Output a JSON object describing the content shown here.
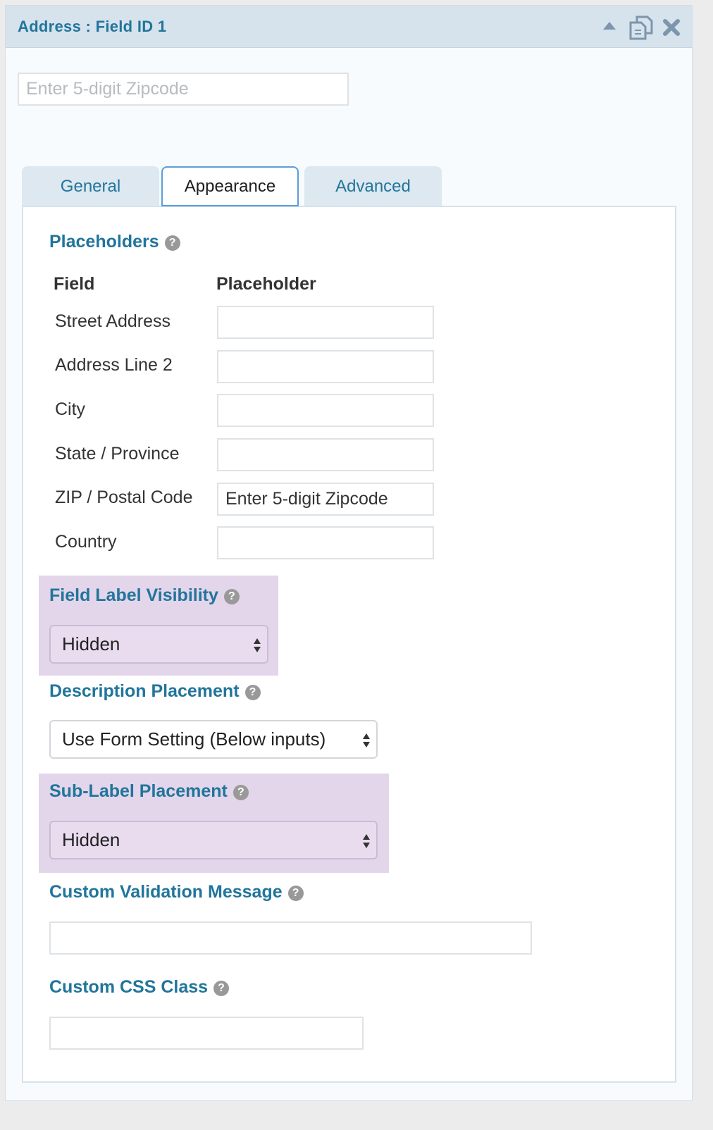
{
  "header": {
    "title": "Address : Field ID 1",
    "icons": [
      "collapse-arrow-icon",
      "duplicate-icon",
      "delete-icon"
    ]
  },
  "preview": {
    "placeholder": "Enter 5-digit Zipcode"
  },
  "tabs": [
    {
      "label": "General",
      "active": false
    },
    {
      "label": "Appearance",
      "active": true
    },
    {
      "label": "Advanced",
      "active": false
    }
  ],
  "placeholders": {
    "title": "Placeholders",
    "col_field": "Field",
    "col_placeholder": "Placeholder",
    "rows": [
      {
        "field": "Street Address",
        "value": ""
      },
      {
        "field": "Address Line 2",
        "value": ""
      },
      {
        "field": "City",
        "value": ""
      },
      {
        "field": "State / Province",
        "value": ""
      },
      {
        "field": "ZIP / Postal Code",
        "value": "Enter 5-digit Zipcode"
      },
      {
        "field": "Country",
        "value": ""
      }
    ]
  },
  "label_visibility": {
    "title": "Field Label Visibility",
    "value": "Hidden"
  },
  "description_placement": {
    "title": "Description Placement",
    "value": "Use Form Setting (Below inputs)"
  },
  "sublabel_placement": {
    "title": "Sub-Label Placement",
    "value": "Hidden"
  },
  "validation_message": {
    "title": "Custom Validation Message",
    "value": ""
  },
  "css_class": {
    "title": "Custom CSS Class",
    "value": ""
  },
  "colors": {
    "accent": "#21759b",
    "header_bg": "#d6e2ec",
    "highlight": "#e3d5ea",
    "active_tab_border": "#5b9dd9"
  }
}
